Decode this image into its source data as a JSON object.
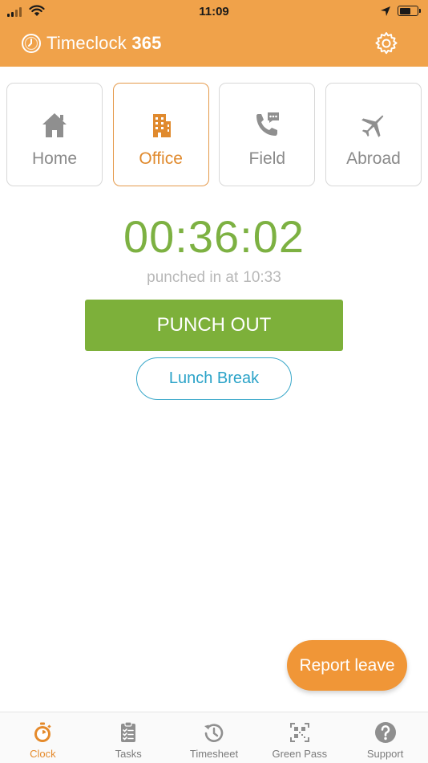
{
  "status_bar": {
    "time": "11:09"
  },
  "app": {
    "brand_name": "Timeclock",
    "brand_number": "365"
  },
  "locations": [
    {
      "label": "Home",
      "icon": "home-icon",
      "active": false
    },
    {
      "label": "Office",
      "icon": "building-icon",
      "active": true
    },
    {
      "label": "Field",
      "icon": "phone-chat-icon",
      "active": false
    },
    {
      "label": "Abroad",
      "icon": "airplane-icon",
      "active": false
    }
  ],
  "timer": {
    "elapsed": "00:36:02",
    "punched_label": "punched in at",
    "punched_time": "10:33"
  },
  "actions": {
    "punch_out": "PUNCH OUT",
    "lunch_break": "Lunch Break",
    "report_leave": "Report leave"
  },
  "tabs": [
    {
      "label": "Clock",
      "icon": "stopwatch-icon",
      "active": true
    },
    {
      "label": "Tasks",
      "icon": "clipboard-icon",
      "active": false
    },
    {
      "label": "Timesheet",
      "icon": "history-icon",
      "active": false
    },
    {
      "label": "Green Pass",
      "icon": "qr-code-icon",
      "active": false
    },
    {
      "label": "Support",
      "icon": "help-icon",
      "active": false
    }
  ],
  "colors": {
    "header": "#F0A24A",
    "accent": "#E58A2B",
    "timer_green": "#7DB142",
    "punch_green": "#7DB03A",
    "lunch_blue": "#2BA3C8",
    "report_orange": "#F09637"
  }
}
